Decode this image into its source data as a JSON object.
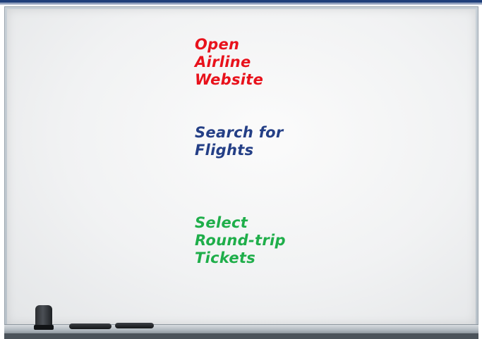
{
  "whiteboard": {
    "note_red": {
      "color": "#e8121c",
      "lines": [
        "Open",
        "Airline",
        "Website"
      ]
    },
    "note_blue": {
      "color": "#243f86",
      "lines": [
        "Search for",
        "Flights"
      ]
    },
    "note_green": {
      "color": "#1fae4a",
      "lines": [
        "Select",
        "Round-trip",
        "Tickets"
      ]
    },
    "frame_color": "#b9c2ca",
    "surface_color": "#f4f5f6"
  },
  "tray_items": [
    "eraser-icon",
    "marker-icon",
    "marker-icon"
  ]
}
